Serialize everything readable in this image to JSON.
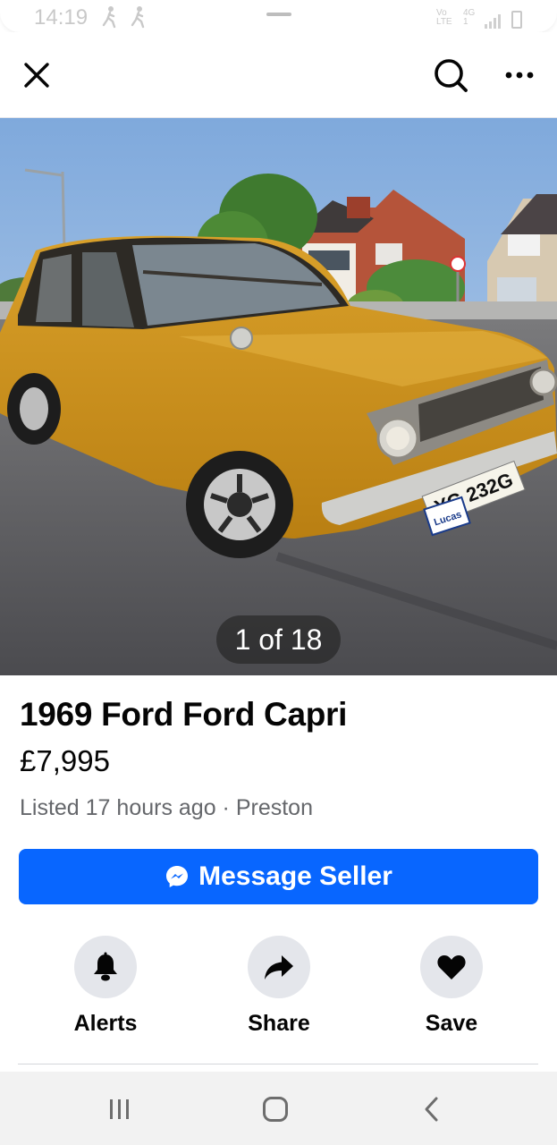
{
  "status_bar": {
    "time": "14:19",
    "network_top": "Vo",
    "network_top_right": "4G",
    "network_bottom": "LTE",
    "network_bottom_right": "1"
  },
  "header": {
    "close_icon": "close-icon",
    "search_icon": "search-icon",
    "more_icon": "more-horizontal-icon"
  },
  "photo": {
    "counter": "1 of 18",
    "plate": "YG 232G",
    "badge": "Lucas"
  },
  "listing": {
    "title": "1969 Ford Ford Capri",
    "price": "£7,995",
    "meta": "Listed 17 hours ago · Preston"
  },
  "message_button": {
    "label": "Message Seller",
    "icon": "messenger-icon",
    "color": "#0866ff"
  },
  "actions": [
    {
      "label": "Alerts",
      "icon": "bell-icon"
    },
    {
      "label": "Share",
      "icon": "share-arrow-icon"
    },
    {
      "label": "Save",
      "icon": "heart-icon"
    }
  ],
  "nav_bar": {
    "recents_icon": "recents-icon",
    "home_icon": "home-icon",
    "back_icon": "back-icon"
  }
}
